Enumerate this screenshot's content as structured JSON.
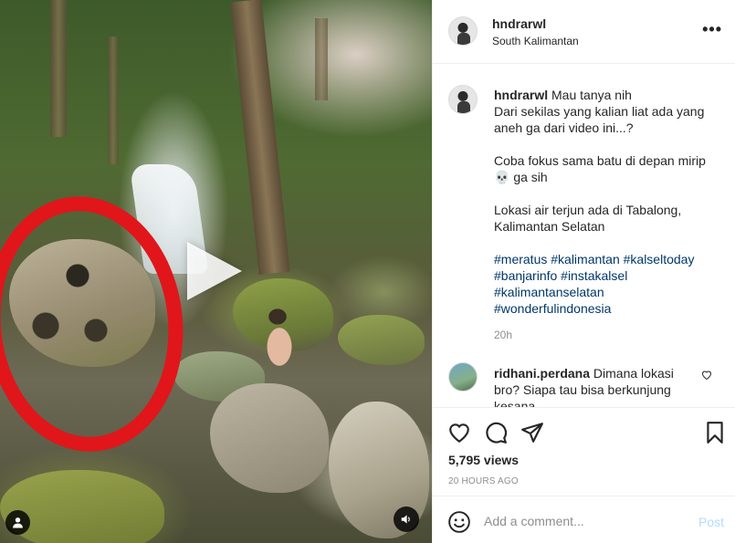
{
  "post": {
    "username": "hndrarwl",
    "location": "South Kalimantan",
    "more_label": "•••"
  },
  "caption": {
    "username": "hndrarwl",
    "lines": [
      "Mau tanya nih",
      "Dari sekilas yang kalian liat ada yang",
      "aneh ga dari video ini...?",
      "",
      "Coba fokus sama batu di depan mirip",
      "💀 ga sih",
      "",
      "Lokasi air terjun ada di Tabalong,",
      "Kalimantan Selatan",
      ""
    ],
    "hashtag_lines": [
      "#meratus #kalimantan #kalseltoday",
      "#banjarinfo #instakalsel",
      "#kalimantanselatan",
      "#wonderfulindonesia"
    ],
    "time": "20h"
  },
  "comment": {
    "username": "ridhani.perdana",
    "text_line1": "Dimana lokasi",
    "text_line2": "bro? Siapa tau bisa berkunjung",
    "text_line3": "kesana"
  },
  "stats": {
    "views": "5,795 views",
    "date": "20 HOURS AGO"
  },
  "add_comment": {
    "placeholder": "Add a comment...",
    "post_label": "Post"
  },
  "colors": {
    "annotation_circle": "#e0161b",
    "hashtag": "#00376b",
    "post_button": "#b3dbff"
  },
  "icons": {
    "play": "play-icon",
    "audio": "speaker-icon",
    "tagged_people": "user-icon",
    "like": "heart-icon",
    "comment": "comment-bubble-icon",
    "share": "paper-plane-icon",
    "save": "bookmark-icon",
    "emoji": "smiley-icon"
  }
}
